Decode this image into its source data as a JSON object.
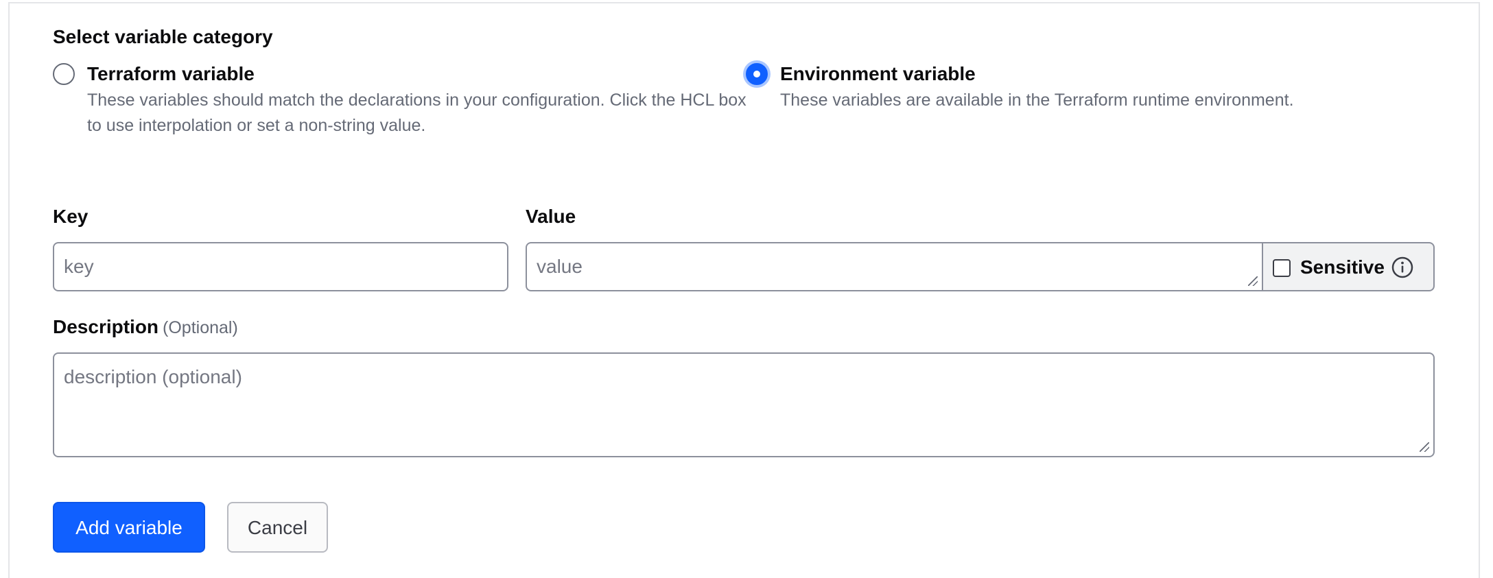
{
  "category": {
    "title": "Select variable category",
    "options": [
      {
        "label": "Terraform variable",
        "help": "These variables should match the declarations in your configuration. Click the HCL box to use interpolation or set a non-string value.",
        "selected": false
      },
      {
        "label": "Environment variable",
        "help": "These variables are available in the Terraform runtime environment.",
        "selected": true
      }
    ]
  },
  "key": {
    "label": "Key",
    "value": "",
    "placeholder": "key"
  },
  "value": {
    "label": "Value",
    "value": "",
    "placeholder": "value"
  },
  "sensitive": {
    "label": "Sensitive",
    "checked": false,
    "icon": "info-icon"
  },
  "description": {
    "label": "Description",
    "optional": "(Optional)",
    "value": "",
    "placeholder": "description (optional)"
  },
  "actions": {
    "add_label": "Add variable",
    "cancel_label": "Cancel"
  },
  "colors": {
    "primary": "#1060ff",
    "focus_ring": "#a9c6ff",
    "muted_text": "#656a76",
    "border": "#8c909c"
  }
}
